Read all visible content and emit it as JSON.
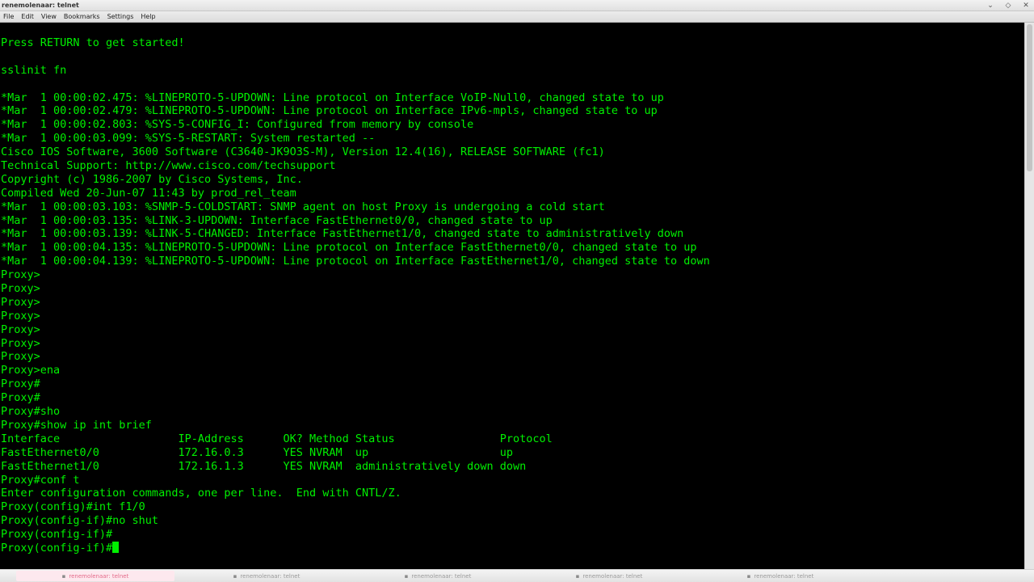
{
  "window": {
    "title": "renemolenaar: telnet",
    "controls": {
      "minimize": "⌄",
      "maximize": "◇",
      "close": "✕"
    }
  },
  "menu": {
    "items": [
      "File",
      "Edit",
      "View",
      "Bookmarks",
      "Settings",
      "Help"
    ]
  },
  "terminal": {
    "text_color": "#00f000",
    "lines": [
      "Press RETURN to get started!",
      "",
      "sslinit fn",
      "",
      "*Mar  1 00:00:02.475: %LINEPROTO-5-UPDOWN: Line protocol on Interface VoIP-Null0, changed state to up",
      "*Mar  1 00:00:02.479: %LINEPROTO-5-UPDOWN: Line protocol on Interface IPv6-mpls, changed state to up",
      "*Mar  1 00:00:02.803: %SYS-5-CONFIG_I: Configured from memory by console",
      "*Mar  1 00:00:03.099: %SYS-5-RESTART: System restarted --",
      "Cisco IOS Software, 3600 Software (C3640-JK9O3S-M), Version 12.4(16), RELEASE SOFTWARE (fc1)",
      "Technical Support: http://www.cisco.com/techsupport",
      "Copyright (c) 1986-2007 by Cisco Systems, Inc.",
      "Compiled Wed 20-Jun-07 11:43 by prod_rel_team",
      "*Mar  1 00:00:03.103: %SNMP-5-COLDSTART: SNMP agent on host Proxy is undergoing a cold start",
      "*Mar  1 00:00:03.135: %LINK-3-UPDOWN: Interface FastEthernet0/0, changed state to up",
      "*Mar  1 00:00:03.139: %LINK-5-CHANGED: Interface FastEthernet1/0, changed state to administratively down",
      "*Mar  1 00:00:04.135: %LINEPROTO-5-UPDOWN: Line protocol on Interface FastEthernet0/0, changed state to up",
      "*Mar  1 00:00:04.139: %LINEPROTO-5-UPDOWN: Line protocol on Interface FastEthernet1/0, changed state to down",
      "Proxy>",
      "Proxy>",
      "Proxy>",
      "Proxy>",
      "Proxy>",
      "Proxy>",
      "Proxy>",
      "Proxy>ena",
      "Proxy#",
      "Proxy#",
      "Proxy#sho",
      "Proxy#show ip int brief",
      "Interface                  IP-Address      OK? Method Status                Protocol",
      "FastEthernet0/0            172.16.0.3      YES NVRAM  up                    up",
      "FastEthernet1/0            172.16.1.3      YES NVRAM  administratively down down",
      "Proxy#conf t",
      "Enter configuration commands, one per line.  End with CNTL/Z.",
      "Proxy(config)#int f1/0",
      "Proxy(config-if)#no shut",
      "Proxy(config-if)#",
      "Proxy(config-if)#"
    ]
  },
  "taskbar": {
    "tabs": [
      {
        "label": "renemolenaar: telnet",
        "active": true
      },
      {
        "label": "renemolenaar: telnet",
        "active": false
      },
      {
        "label": "renemolenaar: telnet",
        "active": false
      },
      {
        "label": "renemolenaar: telnet",
        "active": false
      },
      {
        "label": "renemolenaar: telnet",
        "active": false
      }
    ]
  }
}
